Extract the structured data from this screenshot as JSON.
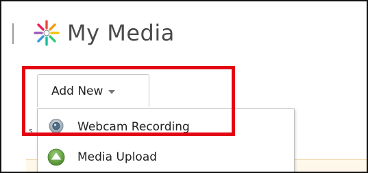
{
  "page": {
    "title": "My Media"
  },
  "toolbar": {
    "add_new_label": "Add New"
  },
  "dropdown": {
    "items": [
      {
        "label": "Webcam Recording",
        "icon": "webcam-icon"
      },
      {
        "label": "Media Upload",
        "icon": "upload-icon"
      }
    ]
  },
  "background": {
    "fragment": "s"
  },
  "colors": {
    "highlight": "#e30613",
    "title_text": "#4a4a4a",
    "upload_green": "#5a9a3a"
  }
}
